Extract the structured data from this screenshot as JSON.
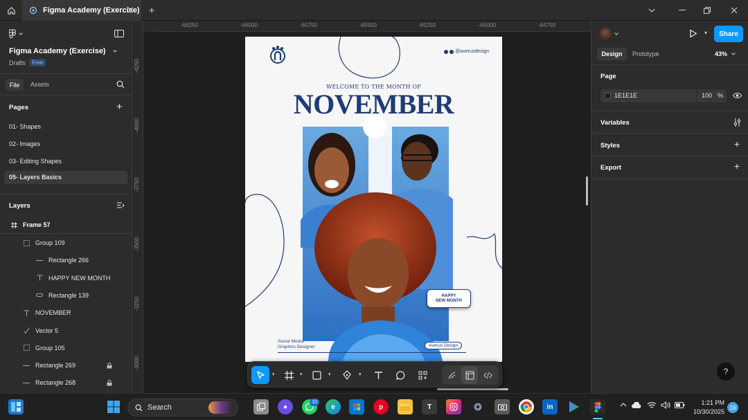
{
  "titlebar": {
    "tab_title": "Figma Academy (Exercise)",
    "close_symbol": "✕",
    "new_tab_symbol": "+"
  },
  "file": {
    "name": "Figma Academy (Exercise)",
    "location": "Drafts",
    "plan_badge": "Free"
  },
  "left_tabs": {
    "file": "File",
    "assets": "Assets"
  },
  "pages": {
    "heading": "Pages",
    "items": [
      {
        "label": "01- Shapes",
        "active": false
      },
      {
        "label": "02- Images",
        "active": false
      },
      {
        "label": "03- Editing Shapes",
        "active": false
      },
      {
        "label": "05- Layers Basics",
        "active": true
      }
    ]
  },
  "layers": {
    "heading": "Layers",
    "frame": "Frame 57",
    "items": [
      {
        "label": "Group 109",
        "icon": "group-icon",
        "locked": false
      },
      {
        "label": "Rectangle 266",
        "icon": "line-icon",
        "locked": false
      },
      {
        "label": "HAPPY NEW MONTH",
        "icon": "text-icon",
        "locked": false
      },
      {
        "label": "Rectangle 139",
        "icon": "rectangle-icon",
        "locked": false
      },
      {
        "label": "NOVEMBER",
        "icon": "text-icon",
        "locked": false
      },
      {
        "label": "Vector 5",
        "icon": "vector-icon",
        "locked": false
      },
      {
        "label": "Group 105",
        "icon": "group-icon",
        "locked": false
      },
      {
        "label": "Rectangle 269",
        "icon": "line-icon",
        "locked": true
      },
      {
        "label": "Rectangle 268",
        "icon": "line-icon",
        "locked": true
      }
    ]
  },
  "rulers": {
    "top": [
      "-66250",
      "-66000",
      "-65750",
      "-65500",
      "-65250",
      "-65000",
      "-64750"
    ],
    "left": [
      "-4250",
      "-4000",
      "-3750",
      "-3500",
      "-3250",
      "-3000"
    ]
  },
  "poster": {
    "handle": "@averusdesign",
    "welcome": "WELCOME TO THE MONTH OF",
    "title": "NOVEMBER",
    "badge_line1": "HAPPY",
    "badge_line2": "NEW MONTH",
    "role_line1": "Social Media",
    "role_line2": "Graphics Designer",
    "brand": "Averus Design"
  },
  "right_panel": {
    "tabs": {
      "design": "Design",
      "prototype": "Prototype"
    },
    "zoom": "43%",
    "share_label": "Share",
    "page_heading": "Page",
    "page_color": "1E1E1E",
    "page_opacity": "100",
    "opacity_unit": "%",
    "variables": "Variables",
    "styles": "Styles",
    "export": "Export",
    "help_symbol": "?"
  },
  "taskbar": {
    "search_placeholder": "Search",
    "whatsapp_badge": "10",
    "time": "1:21 PM",
    "date": "10/30/2025",
    "notification_count": "16"
  },
  "colors": {
    "accent": "#0d99ff",
    "poster_navy": "#1f3c75",
    "canvas_bg": "#1e1e1e",
    "panel_bg": "#2c2c2c"
  }
}
